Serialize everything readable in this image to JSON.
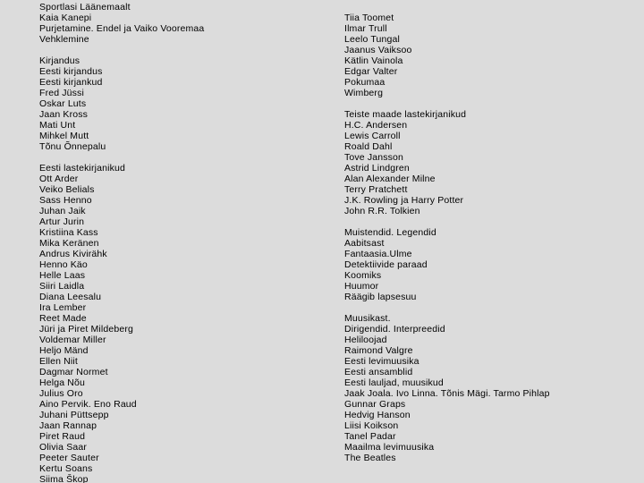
{
  "page": {
    "background_color": "#dcdcdc",
    "text_color": "#000000",
    "title": "Estonian library catalogue subject list"
  },
  "left_column": {
    "lines": [
      "Sportlasi Läänemaalt",
      "Kaia Kanepi",
      "Purjetamine. Endel ja Vaiko Vooremaa",
      "Vehklemine",
      "",
      "Kirjandus",
      "Eesti kirjandus",
      "Eesti kirjankud",
      "Fred Jüssi",
      "Oskar Luts",
      "Jaan Kross",
      "Mati Unt",
      "Mihkel Mutt",
      "Tõnu Õnnepalu",
      "",
      "Eesti lastekirjanikud",
      "Ott Arder",
      "Veiko Belials",
      "Sass Henno",
      "Juhan Jaik",
      "Artur Jurin",
      "Kristiina Kass",
      "Mika Keränen",
      "Andrus Kivirähk",
      "Henno Käo",
      "Helle Laas",
      "Siiri Laidla",
      "Diana Leesalu",
      "Ira Lember",
      "Reet Made",
      "Jüri ja Piret Mildeberg",
      "Voldemar Miller",
      "Heljo Mänd",
      "Ellen Niit",
      "Dagmar Normet",
      "Helga Nõu",
      "Julius Oro",
      "Aino Pervik. Eno Raud",
      "Juhani Püttsepp",
      "Jaan Rannap",
      "Piret Raud",
      "Olivia Saar",
      "Peeter Sauter",
      "Kertu Soans",
      "Siima Škop"
    ]
  },
  "right_column": {
    "lines": [
      "Tiia Toomet",
      "Ilmar Trull",
      "Leelo Tungal",
      "Jaanus Vaiksoo",
      "Kätlin Vainola",
      "Edgar Valter",
      "Pokumaa",
      "Wimberg",
      "",
      "Teiste maade lastekirjanikud",
      "H.C. Andersen",
      "Lewis Carroll",
      "Roald Dahl",
      "Tove Jansson",
      "Astrid Lindgren",
      "Alan Alexander Milne",
      "Terry Pratchett",
      "J.K. Rowling ja Harry Potter",
      "John R.R. Tolkien",
      "",
      "Muistendid. Legendid",
      "Aabitsast",
      "Fantaasia.Ulme",
      "Detektiivide paraad",
      "Koomiks",
      "Huumor",
      "Räägib lapsesuu",
      "",
      "Muusikast.",
      "Dirigendid. Interpreedid",
      "Heliloojad",
      "Raimond Valgre",
      "Eesti levimuusika",
      "Eesti ansamblid",
      "Eesti lauljad, muusikud",
      "Jaak Joala. Ivo Linna. Tõnis Mägi. Tarmo Pihlap",
      "Gunnar Graps",
      "Hedvig Hanson",
      "Liisi Koikson",
      "Tanel Padar",
      "Maailma levimuusika",
      "The Beatles"
    ]
  }
}
